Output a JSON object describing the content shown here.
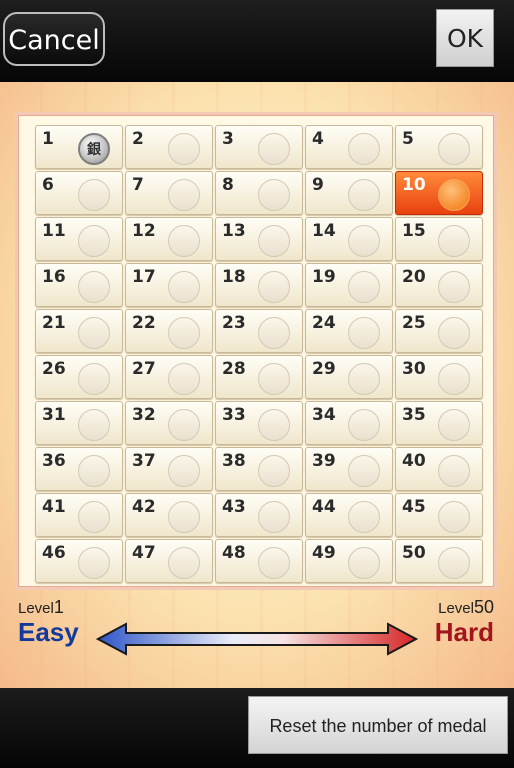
{
  "header": {
    "cancel_label": "Cancel",
    "ok_label": "OK"
  },
  "levels": [
    {
      "n": "1",
      "medal": "銀"
    },
    {
      "n": "2"
    },
    {
      "n": "3"
    },
    {
      "n": "4"
    },
    {
      "n": "5"
    },
    {
      "n": "6"
    },
    {
      "n": "7"
    },
    {
      "n": "8"
    },
    {
      "n": "9"
    },
    {
      "n": "10",
      "current": true
    },
    {
      "n": "11"
    },
    {
      "n": "12"
    },
    {
      "n": "13"
    },
    {
      "n": "14"
    },
    {
      "n": "15"
    },
    {
      "n": "16"
    },
    {
      "n": "17"
    },
    {
      "n": "18"
    },
    {
      "n": "19"
    },
    {
      "n": "20"
    },
    {
      "n": "21"
    },
    {
      "n": "22"
    },
    {
      "n": "23"
    },
    {
      "n": "24"
    },
    {
      "n": "25"
    },
    {
      "n": "26"
    },
    {
      "n": "27"
    },
    {
      "n": "28"
    },
    {
      "n": "29"
    },
    {
      "n": "30"
    },
    {
      "n": "31"
    },
    {
      "n": "32"
    },
    {
      "n": "33"
    },
    {
      "n": "34"
    },
    {
      "n": "35"
    },
    {
      "n": "36"
    },
    {
      "n": "37"
    },
    {
      "n": "38"
    },
    {
      "n": "39"
    },
    {
      "n": "40"
    },
    {
      "n": "41"
    },
    {
      "n": "42"
    },
    {
      "n": "43"
    },
    {
      "n": "44"
    },
    {
      "n": "45"
    },
    {
      "n": "46"
    },
    {
      "n": "47"
    },
    {
      "n": "48"
    },
    {
      "n": "49"
    },
    {
      "n": "50"
    }
  ],
  "legend": {
    "left_small": "Level",
    "left_num": "1",
    "left_word": "Easy",
    "right_small": "Level",
    "right_num": "50",
    "right_word": "Hard",
    "easy_color": "#123a9c",
    "hard_color": "#a3141c"
  },
  "footer": {
    "reset_label": "Reset the number of medal"
  },
  "colors": {
    "current_level": "#f0541a"
  }
}
